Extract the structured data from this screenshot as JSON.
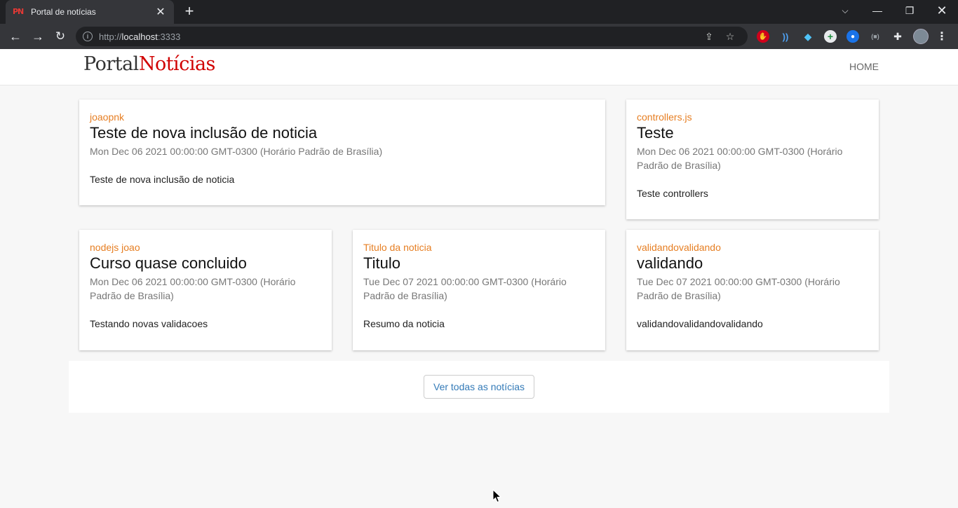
{
  "browser": {
    "tab_title": "Portal de notícias",
    "favicon_text": "PN",
    "url_prefix": "http://",
    "url_host": "localhost",
    "url_port": ":3333"
  },
  "site": {
    "logo_part1": "Portal",
    "logo_part2": "Notícias",
    "nav_home": "HOME",
    "colors": {
      "logo_red": "#d00000",
      "category": "#e67e22",
      "link": "#337ab7"
    }
  },
  "news": [
    {
      "category": "joaopnk",
      "title": "Teste de nova inclusão de noticia",
      "date": "Mon Dec 06 2021 00:00:00 GMT-0300 (Horário Padrão de Brasília)",
      "summary": "Teste de nova inclusão de noticia"
    },
    {
      "category": "controllers.js",
      "title": "Teste",
      "date": "Mon Dec 06 2021 00:00:00 GMT-0300 (Horário Padrão de Brasília)",
      "summary": "Teste controllers"
    },
    {
      "category": "nodejs joao",
      "title": "Curso quase concluido",
      "date": "Mon Dec 06 2021 00:00:00 GMT-0300 (Horário Padrão de Brasília)",
      "summary": "Testando novas validacoes"
    },
    {
      "category": "Titulo da noticia",
      "title": "Titulo",
      "date": "Tue Dec 07 2021 00:00:00 GMT-0300 (Horário Padrão de Brasília)",
      "summary": "Resumo da noticia"
    },
    {
      "category": "validandovalidando",
      "title": "validando",
      "date": "Tue Dec 07 2021 00:00:00 GMT-0300 (Horário Padrão de Brasília)",
      "summary": "validandovalidandovalidando"
    }
  ],
  "more_button": "Ver todas as notícias"
}
